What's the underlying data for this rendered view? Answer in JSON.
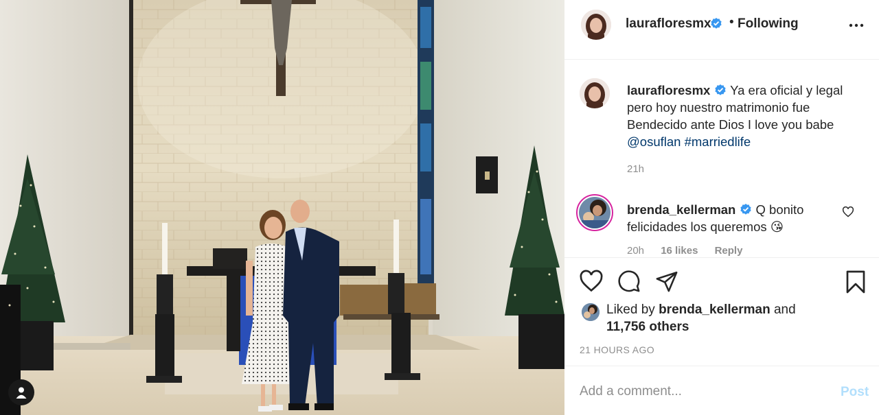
{
  "post_author": {
    "username": "laurafloresmx",
    "verified": true,
    "separator": "•",
    "follow_status": "Following",
    "more_icon": "more-horizontal-icon"
  },
  "caption": {
    "username": "laurafloresmx",
    "text_lines": [
      "Ya era oficial y legal",
      "pero hoy nuestro matrimonio fue",
      "Bendecido ante Dios I love you babe"
    ],
    "mention": "@osuflan",
    "hashtag": "#marriedlife",
    "time": "21h"
  },
  "comments": [
    {
      "username": "brenda_kellerman",
      "verified": true,
      "text_first": "Q bonito",
      "text_second": "felicidades los queremos",
      "emoji": "😘",
      "time": "20h",
      "likes": "16 likes",
      "reply": "Reply"
    }
  ],
  "actions": {
    "icons": [
      "heart-icon",
      "comment-icon",
      "share-icon",
      "bookmark-icon"
    ]
  },
  "likes": {
    "prefix": "Liked by",
    "username": "brenda_kellerman",
    "and": "and",
    "others": "11,756 others"
  },
  "timestamp": "21 HOURS AGO",
  "add_comment": {
    "placeholder": "Add a comment...",
    "post_label": "Post"
  },
  "colors": {
    "verified_blue": "#3897f0",
    "link_blue": "#00376b",
    "post_disabled": "#b2dffc",
    "border": "#efefef"
  }
}
